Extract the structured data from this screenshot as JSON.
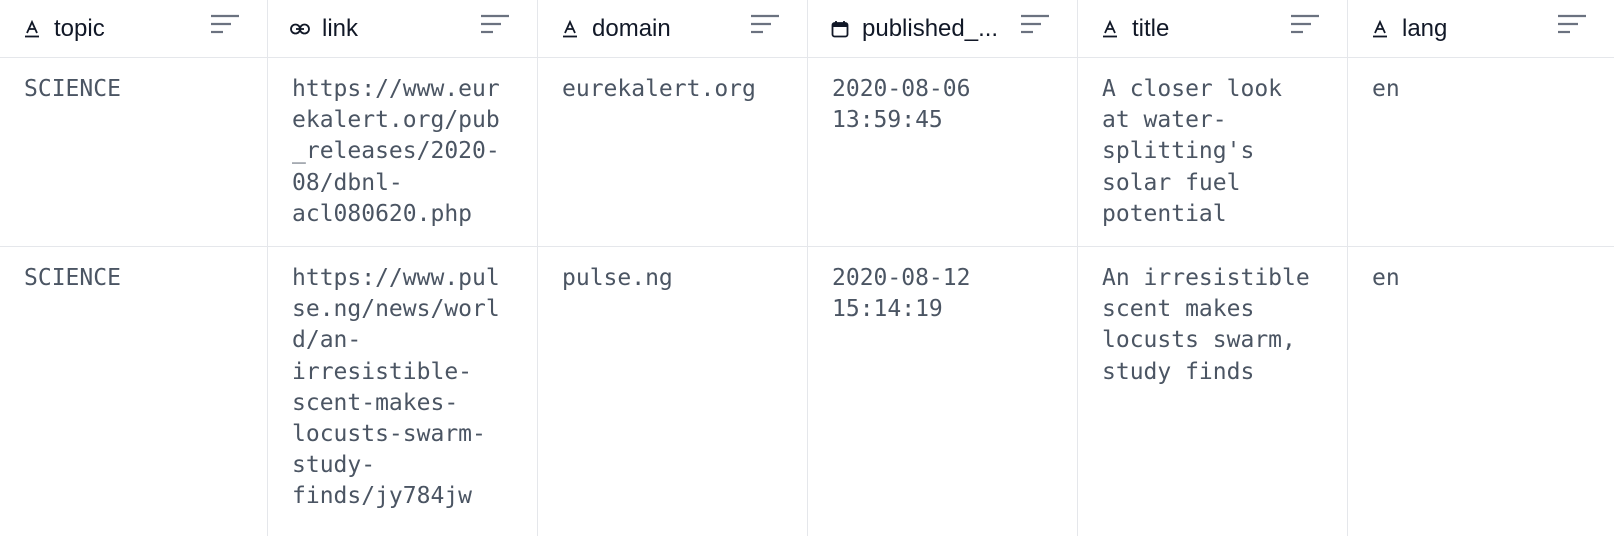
{
  "columns": [
    {
      "label": "topic",
      "type_icon": "text-type-icon"
    },
    {
      "label": "link",
      "type_icon": "link-icon"
    },
    {
      "label": "domain",
      "type_icon": "text-type-icon"
    },
    {
      "label": "published_...",
      "type_icon": "calendar-icon"
    },
    {
      "label": "title",
      "type_icon": "text-type-icon"
    },
    {
      "label": "lang",
      "type_icon": "text-type-icon"
    }
  ],
  "rows": [
    {
      "topic": "SCIENCE",
      "link": "https://www.eur\nekalert.org/pub\n_releases/2020-\n08/dbnl-\nacl080620.php",
      "domain": "eurekalert.org",
      "published": "2020-08-06\n13:59:45",
      "title": "A closer look\nat water-\nsplitting's\nsolar fuel\npotential",
      "lang": "en"
    },
    {
      "topic": "SCIENCE",
      "link": "https://www.pul\nse.ng/news/worl\nd/an-\nirresistible-\nscent-makes-\nlocusts-swarm-\nstudy-\nfinds/jy784jw",
      "domain": "pulse.ng",
      "published": "2020-08-12\n15:14:19",
      "title": "An irresistible\nscent makes\nlocusts swarm,\nstudy finds",
      "lang": "en"
    }
  ],
  "colors": {
    "header_text": "#111827",
    "cell_text": "#4b5563",
    "border": "#e5e7eb",
    "icon": "#6b7280"
  }
}
